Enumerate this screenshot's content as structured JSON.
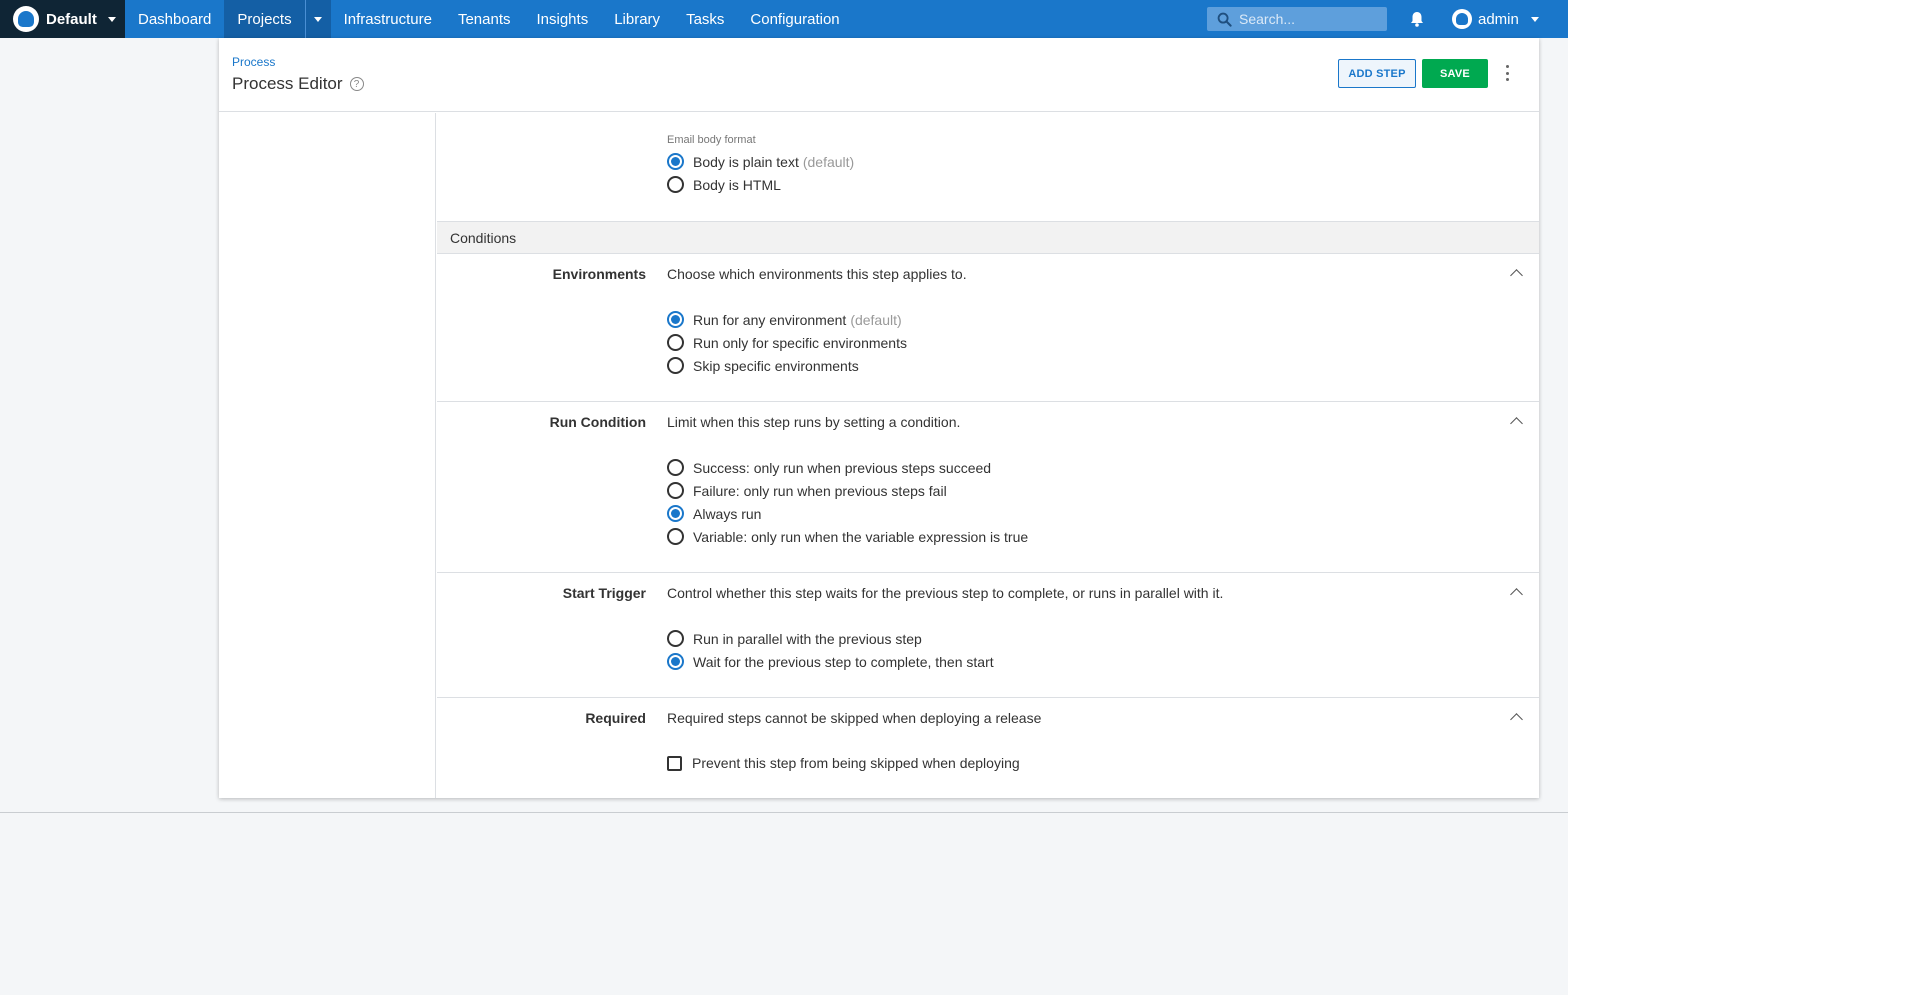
{
  "colors": {
    "nav_bg": "#1a77ca",
    "space_bg": "#0f2535",
    "active_nav_bg": "#145fa5",
    "save_green": "#00a950",
    "radio_blue": "#1a77ca"
  },
  "topnav": {
    "space_name": "Default",
    "links": {
      "dashboard": "Dashboard",
      "projects": "Projects",
      "infrastructure": "Infrastructure",
      "tenants": "Tenants",
      "insights": "Insights",
      "library": "Library",
      "tasks": "Tasks",
      "configuration": "Configuration"
    },
    "active": "Projects",
    "search_placeholder": "Search...",
    "user_name": "admin"
  },
  "header": {
    "breadcrumb": "Process",
    "title": "Process Editor",
    "add_step_label": "ADD STEP",
    "save_label": "SAVE"
  },
  "email_format": {
    "label": "Email body format",
    "options": [
      {
        "label": "Body is plain text",
        "suffix": "(default)",
        "selected": true
      },
      {
        "label": "Body is HTML",
        "suffix": "",
        "selected": false
      }
    ]
  },
  "conditions": {
    "title": "Conditions",
    "environments": {
      "label": "Environments",
      "description": "Choose which environments this step applies to.",
      "options": [
        {
          "label": "Run for any environment",
          "suffix": "(default)",
          "selected": true
        },
        {
          "label": "Run only for specific environments",
          "suffix": "",
          "selected": false
        },
        {
          "label": "Skip specific environments",
          "suffix": "",
          "selected": false
        }
      ]
    },
    "run_condition": {
      "label": "Run Condition",
      "description": "Limit when this step runs by setting a condition.",
      "options": [
        {
          "label": "Success: only run when previous steps succeed",
          "selected": false
        },
        {
          "label": "Failure: only run when previous steps fail",
          "selected": false
        },
        {
          "label": "Always run",
          "selected": true
        },
        {
          "label": "Variable: only run when the variable expression is true",
          "selected": false
        }
      ]
    },
    "start_trigger": {
      "label": "Start Trigger",
      "description": "Control whether this step waits for the previous step to complete, or runs in parallel with it.",
      "options": [
        {
          "label": "Run in parallel with the previous step",
          "selected": false
        },
        {
          "label": "Wait for the previous step to complete, then start",
          "selected": true
        }
      ]
    },
    "required": {
      "label": "Required",
      "description": "Required steps cannot be skipped when deploying a release",
      "checkbox_label": "Prevent this step from being skipped when deploying",
      "checked": false
    }
  }
}
